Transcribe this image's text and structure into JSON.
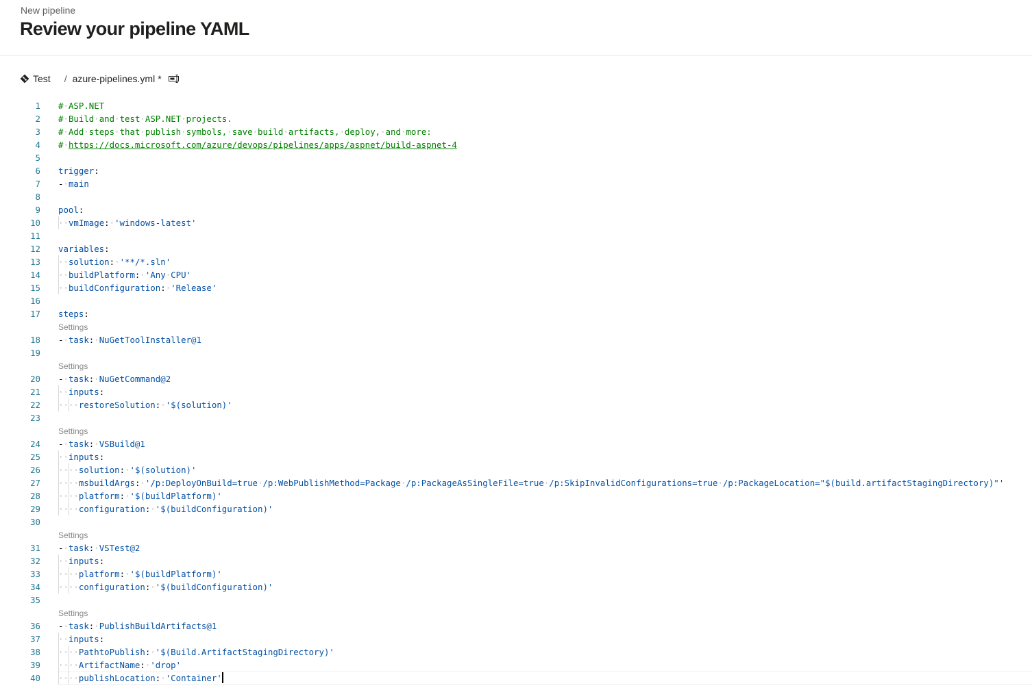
{
  "header": {
    "eyebrow": "New pipeline",
    "title": "Review your pipeline YAML"
  },
  "path": {
    "branch": "Test",
    "separator": "/",
    "file": "azure-pipelines.yml",
    "modified_marker": "*"
  },
  "icons": {
    "branch": "git-branch-icon",
    "rename": "rename-icon"
  },
  "lens_label": "Settings",
  "colors": {
    "comment": "#008000",
    "key": "#0451a5",
    "line_number": "#237893",
    "codelens": "#8a8886"
  },
  "editor": {
    "lines": [
      {
        "n": "1",
        "t": "# ASP.NET"
      },
      {
        "n": "2",
        "t": "# Build and test ASP.NET projects."
      },
      {
        "n": "3",
        "t": "# Add steps that publish symbols, save build artifacts, deploy, and more:"
      },
      {
        "n": "4",
        "t": "# https://docs.microsoft.com/azure/devops/pipelines/apps/aspnet/build-aspnet-4"
      },
      {
        "n": "5",
        "t": ""
      },
      {
        "n": "6",
        "t": "trigger:"
      },
      {
        "n": "7",
        "t": "- main"
      },
      {
        "n": "8",
        "t": ""
      },
      {
        "n": "9",
        "t": "pool:"
      },
      {
        "n": "10",
        "t": "  vmImage: 'windows-latest'"
      },
      {
        "n": "11",
        "t": ""
      },
      {
        "n": "12",
        "t": "variables:"
      },
      {
        "n": "13",
        "t": "  solution: '**/*.sln'"
      },
      {
        "n": "14",
        "t": "  buildPlatform: 'Any CPU'"
      },
      {
        "n": "15",
        "t": "  buildConfiguration: 'Release'"
      },
      {
        "n": "16",
        "t": ""
      },
      {
        "n": "17",
        "t": "steps:"
      },
      {
        "lens": true
      },
      {
        "n": "18",
        "t": "- task: NuGetToolInstaller@1"
      },
      {
        "n": "19",
        "t": ""
      },
      {
        "lens": true
      },
      {
        "n": "20",
        "t": "- task: NuGetCommand@2"
      },
      {
        "n": "21",
        "t": "  inputs:"
      },
      {
        "n": "22",
        "t": "    restoreSolution: '$(solution)'"
      },
      {
        "n": "23",
        "t": ""
      },
      {
        "lens": true
      },
      {
        "n": "24",
        "t": "- task: VSBuild@1"
      },
      {
        "n": "25",
        "t": "  inputs:"
      },
      {
        "n": "26",
        "t": "    solution: '$(solution)'"
      },
      {
        "n": "27",
        "t": "    msbuildArgs: '/p:DeployOnBuild=true /p:WebPublishMethod=Package /p:PackageAsSingleFile=true /p:SkipInvalidConfigurations=true /p:PackageLocation=\"$(build.artifactStagingDirectory)\"'"
      },
      {
        "n": "28",
        "t": "    platform: '$(buildPlatform)'"
      },
      {
        "n": "29",
        "t": "    configuration: '$(buildConfiguration)'"
      },
      {
        "n": "30",
        "t": ""
      },
      {
        "lens": true
      },
      {
        "n": "31",
        "t": "- task: VSTest@2"
      },
      {
        "n": "32",
        "t": "  inputs:"
      },
      {
        "n": "33",
        "t": "    platform: '$(buildPlatform)'"
      },
      {
        "n": "34",
        "t": "    configuration: '$(buildConfiguration)'"
      },
      {
        "n": "35",
        "t": ""
      },
      {
        "lens": true
      },
      {
        "n": "36",
        "t": "- task: PublishBuildArtifacts@1"
      },
      {
        "n": "37",
        "t": "  inputs:"
      },
      {
        "n": "38",
        "t": "    PathtoPublish: '$(Build.ArtifactStagingDirectory)'"
      },
      {
        "n": "39",
        "t": "    ArtifactName: 'drop'"
      },
      {
        "n": "40",
        "t": "    publishLocation: 'Container'",
        "cursor": true
      }
    ]
  }
}
